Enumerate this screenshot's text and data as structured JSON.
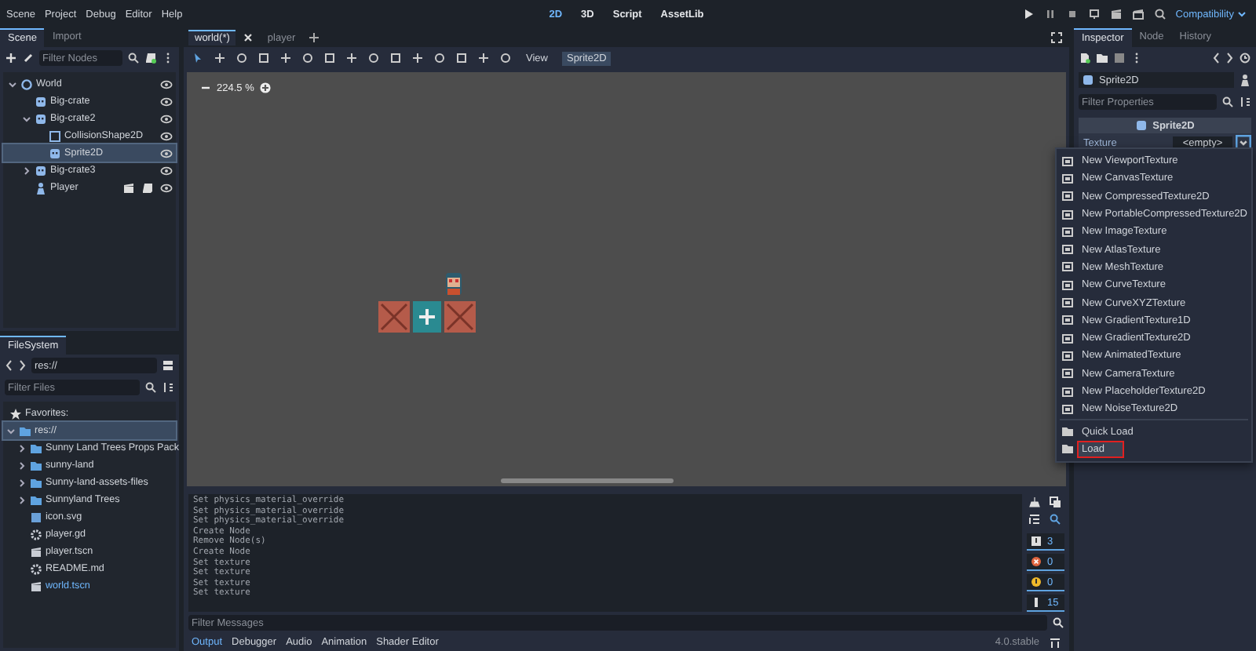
{
  "menu": [
    "Scene",
    "Project",
    "Debug",
    "Editor",
    "Help"
  ],
  "workspaces": [
    {
      "label": "2D",
      "selected": true
    },
    {
      "label": "3D",
      "selected": false
    },
    {
      "label": "Script",
      "selected": false
    },
    {
      "label": "AssetLib",
      "selected": false
    }
  ],
  "renderer": "Compatibility",
  "scene_dock": {
    "tabs": [
      {
        "label": "Scene",
        "selected": true
      },
      {
        "label": "Import",
        "selected": false
      }
    ],
    "filter": {
      "placeholder": "Filter Nodes"
    },
    "tree": [
      {
        "name": "World",
        "kind": "node2d",
        "expanded": true,
        "selected": false,
        "script": false,
        "children": [
          {
            "name": "Big-crate",
            "kind": "sprite",
            "selected": false,
            "script": false
          },
          {
            "name": "Big-crate2",
            "kind": "sprite",
            "expanded": true,
            "selected": false,
            "script": false,
            "children": [
              {
                "name": "CollisionShape2D",
                "kind": "collision",
                "selected": false,
                "script": false
              },
              {
                "name": "Sprite2D",
                "kind": "sprite",
                "selected": true,
                "script": false
              }
            ]
          },
          {
            "name": "Big-crate3",
            "kind": "sprite",
            "expanded": false,
            "selected": false,
            "script": false
          },
          {
            "name": "Player",
            "kind": "character",
            "selected": false,
            "script": true
          }
        ]
      }
    ]
  },
  "editor_tabs": [
    {
      "label": "world(*)",
      "selected": true
    },
    {
      "label": "player",
      "selected": false
    }
  ],
  "viewport_toolbar": {
    "view": "View",
    "node": "Sprite2D"
  },
  "zoom": "224.5 %",
  "filesystem": {
    "tab": "FileSystem",
    "path": "res://",
    "filter": {
      "placeholder": "Filter Files"
    },
    "favorites": "Favorites:",
    "tree": [
      {
        "name": "res://",
        "kind": "folder",
        "expanded": true,
        "selected": true,
        "children": [
          {
            "name": "Sunny Land Trees Props Pack",
            "kind": "folder",
            "expanded": false,
            "selected": false
          },
          {
            "name": "sunny-land",
            "kind": "folder",
            "expanded": false,
            "selected": false
          },
          {
            "name": "Sunny-land-assets-files",
            "kind": "folder",
            "expanded": false,
            "selected": false
          },
          {
            "name": "Sunnyland Trees",
            "kind": "folder",
            "expanded": false,
            "selected": false
          },
          {
            "name": "icon.svg",
            "kind": "image",
            "selected": false
          },
          {
            "name": "player.gd",
            "kind": "script",
            "selected": false
          },
          {
            "name": "player.tscn",
            "kind": "scene",
            "selected": false
          },
          {
            "name": "README.md",
            "kind": "script",
            "selected": false
          },
          {
            "name": "world.tscn",
            "kind": "scene",
            "selected": false,
            "open": true
          }
        ]
      }
    ]
  },
  "inspector": {
    "tabs": [
      {
        "label": "Inspector",
        "selected": true
      },
      {
        "label": "Node",
        "selected": false
      },
      {
        "label": "History",
        "selected": false
      }
    ],
    "object": "Sprite2D",
    "filter": {
      "placeholder": "Filter Properties"
    },
    "section": "Sprite2D",
    "property": {
      "name": "Texture",
      "value": "<empty>"
    }
  },
  "texture_menu": [
    {
      "label": "New ViewportTexture",
      "kind": "new",
      "highlighted": false
    },
    {
      "label": "New CanvasTexture",
      "kind": "new",
      "highlighted": false
    },
    {
      "label": "New CompressedTexture2D",
      "kind": "new",
      "highlighted": false
    },
    {
      "label": "New PortableCompressedTexture2D",
      "kind": "new",
      "highlighted": false
    },
    {
      "label": "New ImageTexture",
      "kind": "new",
      "highlighted": false
    },
    {
      "label": "New AtlasTexture",
      "kind": "new",
      "highlighted": false
    },
    {
      "label": "New MeshTexture",
      "kind": "new",
      "highlighted": false
    },
    {
      "label": "New CurveTexture",
      "kind": "new",
      "highlighted": false
    },
    {
      "label": "New CurveXYZTexture",
      "kind": "new",
      "highlighted": false
    },
    {
      "label": "New GradientTexture1D",
      "kind": "new",
      "highlighted": false
    },
    {
      "label": "New GradientTexture2D",
      "kind": "new",
      "highlighted": false
    },
    {
      "label": "New AnimatedTexture",
      "kind": "new",
      "highlighted": false
    },
    {
      "label": "New CameraTexture",
      "kind": "new",
      "highlighted": false
    },
    {
      "label": "New PlaceholderTexture2D",
      "kind": "new",
      "highlighted": false
    },
    {
      "label": "New NoiseTexture2D",
      "kind": "new",
      "highlighted": false
    },
    {
      "label": "Quick Load",
      "kind": "load",
      "highlighted": false
    },
    {
      "label": "Load",
      "kind": "load",
      "highlighted": true
    }
  ],
  "output": {
    "lines": [
      "Set physics_material_override",
      "Set physics_material_override",
      "Set physics_material_override",
      "Create Node",
      "Remove Node(s)",
      "Create Node",
      "Set texture",
      "Set texture",
      "Set texture",
      "Set texture"
    ],
    "filter": {
      "placeholder": "Filter Messages"
    },
    "counters": [
      {
        "kind": "message",
        "count": "3"
      },
      {
        "kind": "error",
        "count": "0"
      },
      {
        "kind": "warning",
        "count": "0"
      },
      {
        "kind": "editor",
        "count": "15"
      }
    ]
  },
  "bottom_tabs": [
    {
      "label": "Output",
      "selected": true
    },
    {
      "label": "Debugger",
      "selected": false
    },
    {
      "label": "Audio",
      "selected": false
    },
    {
      "label": "Animation",
      "selected": false
    },
    {
      "label": "Shader Editor",
      "selected": false
    }
  ],
  "version": "4.0.stable"
}
